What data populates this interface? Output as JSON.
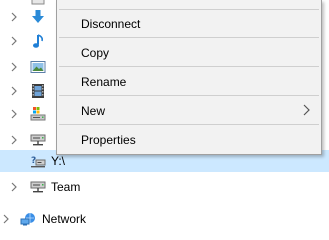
{
  "tree": {
    "drive_y_label": "Y:\\",
    "team_label": "Team",
    "network_label": "Network"
  },
  "context_menu": {
    "items": [
      "Disconnect",
      "Copy",
      "Rename",
      "New",
      "Properties"
    ]
  },
  "colors": {
    "selection": "#cce8ff",
    "menu_bg": "#f2f2f2",
    "menu_border": "#a0a0a0",
    "separator": "#cfcfcf",
    "download_blue": "#2a8ad7",
    "music_blue": "#1f7fd6"
  },
  "icons": {
    "expand": "chevron-right-icon",
    "downloads": "downloads-arrow-icon",
    "music": "music-note-icon",
    "pictures": "pictures-icon",
    "videos": "video-film-icon",
    "local_disk": "local-disk-icon",
    "network_drive": "network-drive-icon",
    "disconnected_drive": "disconnected-drive-icon",
    "network": "network-icon",
    "submenu": "chevron-right-icon"
  }
}
